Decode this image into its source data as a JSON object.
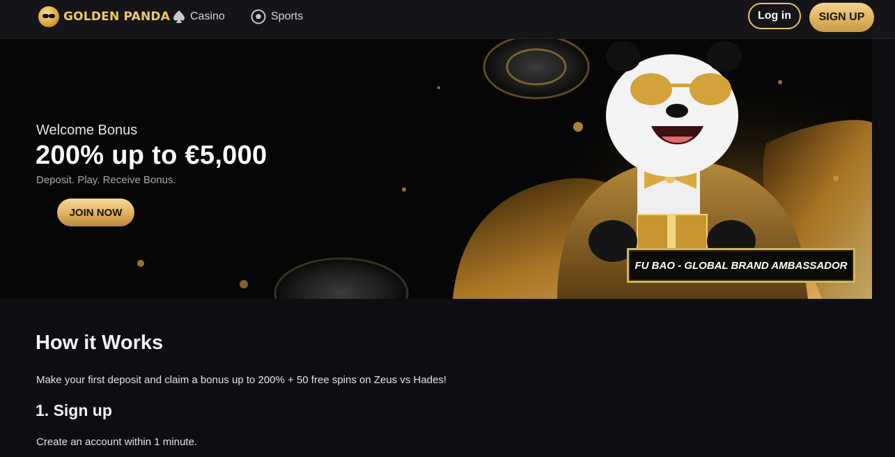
{
  "header": {
    "brand": "GOLDEN PANDA",
    "nav": [
      {
        "label": "Casino",
        "icon": "spade-icon"
      },
      {
        "label": "Sports",
        "icon": "soccer-ball-icon"
      }
    ],
    "login_label": "Log in",
    "signup_label": "SIGN UP"
  },
  "hero": {
    "welcome": "Welcome Bonus",
    "headline": "200% up to €5,000",
    "subtext": "Deposit. Play. Receive Bonus.",
    "cta_label": "JOIN NOW",
    "ambassador_caption": "FU BAO - GLOBAL BRAND AMBASSADOR"
  },
  "content": {
    "title": "How it Works",
    "intro": "Make your first deposit and claim a bonus up to 200% + 50 free spins on Zeus vs Hades!",
    "step1_title": "1. Sign up",
    "step1_text": "Create an account within 1 minute."
  },
  "colors": {
    "background": "#0e0e12",
    "header": "#151519",
    "accent_gold": "#e7c071",
    "text": "#f2f2f2"
  }
}
